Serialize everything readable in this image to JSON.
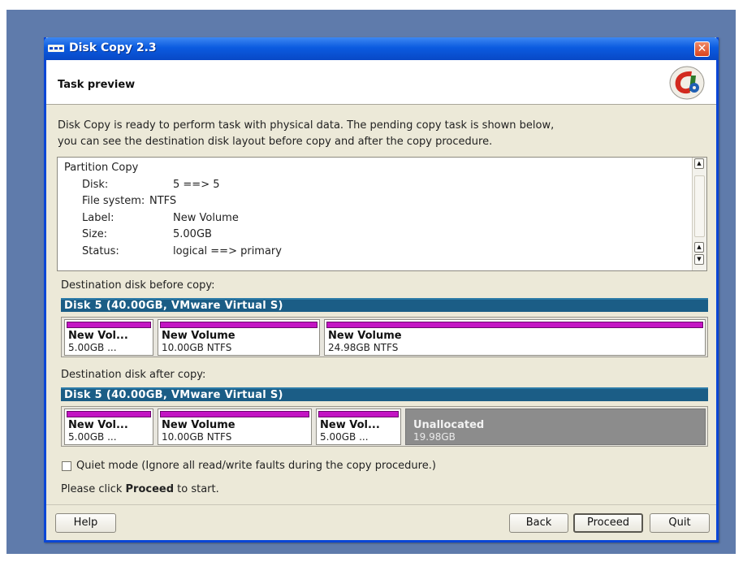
{
  "window": {
    "title": "Disk Copy 2.3",
    "close_glyph": "✕"
  },
  "header": {
    "title": "Task preview",
    "logo_icon": "disk-copy-logo-icon"
  },
  "intro": {
    "line1": "Disk Copy is ready to perform task with physical data. The pending copy task is shown below,",
    "line2": "you can see the destination disk layout before copy and after the copy procedure."
  },
  "task": {
    "heading": "Partition Copy",
    "rows": [
      {
        "key": "Disk:",
        "value": "5 ==> 5"
      },
      {
        "key": "File system:",
        "value": "NTFS"
      },
      {
        "key": "Label:",
        "value": "New Volume"
      },
      {
        "key": "Size:",
        "value": "5.00GB"
      },
      {
        "key": "Status:",
        "value": "logical ==> primary"
      }
    ]
  },
  "before": {
    "label": "Destination disk before copy:",
    "disk": "Disk 5 (40.00GB, VMware Virtual S)",
    "partitions": [
      {
        "name": "New Vol...",
        "size": "5.00GB ..."
      },
      {
        "name": "New Volume",
        "size": "10.00GB NTFS"
      },
      {
        "name": "New Volume",
        "size": "24.98GB NTFS"
      }
    ]
  },
  "after": {
    "label": "Destination disk after copy:",
    "disk": "Disk 5 (40.00GB, VMware Virtual S)",
    "partitions": [
      {
        "name": "New Vol...",
        "size": "5.00GB ..."
      },
      {
        "name": "New Volume",
        "size": "10.00GB NTFS"
      },
      {
        "name": "New Vol...",
        "size": "5.00GB ..."
      },
      {
        "name": "Unallocated",
        "size": "19.98GB"
      }
    ]
  },
  "options": {
    "quiet_mode": "Quiet mode (Ignore all read/write faults during the copy procedure.)",
    "quiet_checked": false
  },
  "prompt": {
    "before": "Please click ",
    "bold": "Proceed",
    "after": " to start."
  },
  "buttons": {
    "help": "Help",
    "back": "Back",
    "proceed": "Proceed",
    "quit": "Quit"
  },
  "colors": {
    "partition_bar": "#c314c3",
    "disk_bar": "#1b5d86",
    "titlebar": "#0b5be0",
    "unallocated": "#8c8c8c"
  }
}
